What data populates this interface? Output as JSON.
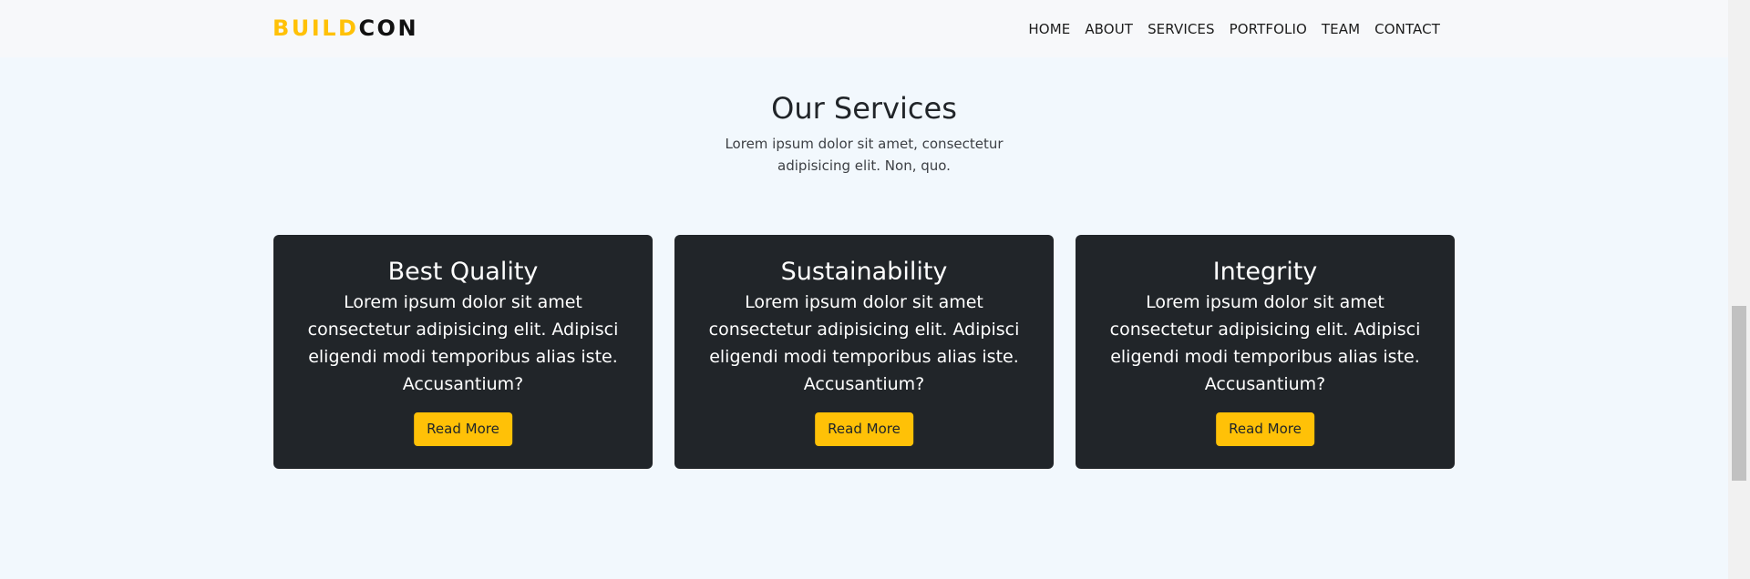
{
  "navbar": {
    "brand_part1": "BUILD",
    "brand_part2": "CON",
    "links": [
      "HOME",
      "ABOUT",
      "SERVICES",
      "PORTFOLIO",
      "TEAM",
      "CONTACT"
    ]
  },
  "services": {
    "title": "Our Services",
    "subtitle": "Lorem ipsum dolor sit amet, consectetur adipisicing elit. Non, quo.",
    "cards": [
      {
        "title": "Best Quality",
        "text": "Lorem ipsum dolor sit amet consectetur adipisicing elit. Adipisci eligendi modi temporibus alias iste. Accusantium?",
        "button": "Read More"
      },
      {
        "title": "Sustainability",
        "text": "Lorem ipsum dolor sit amet consectetur adipisicing elit. Adipisci eligendi modi temporibus alias iste. Accusantium?",
        "button": "Read More"
      },
      {
        "title": "Integrity",
        "text": "Lorem ipsum dolor sit amet consectetur adipisicing elit. Adipisci eligendi modi temporibus alias iste. Accusantium?",
        "button": "Read More"
      }
    ]
  },
  "colors": {
    "accent": "#ffc107",
    "card_bg": "#212529",
    "page_bg": "#f2f8fd",
    "navbar_bg": "#f7f8fa"
  }
}
